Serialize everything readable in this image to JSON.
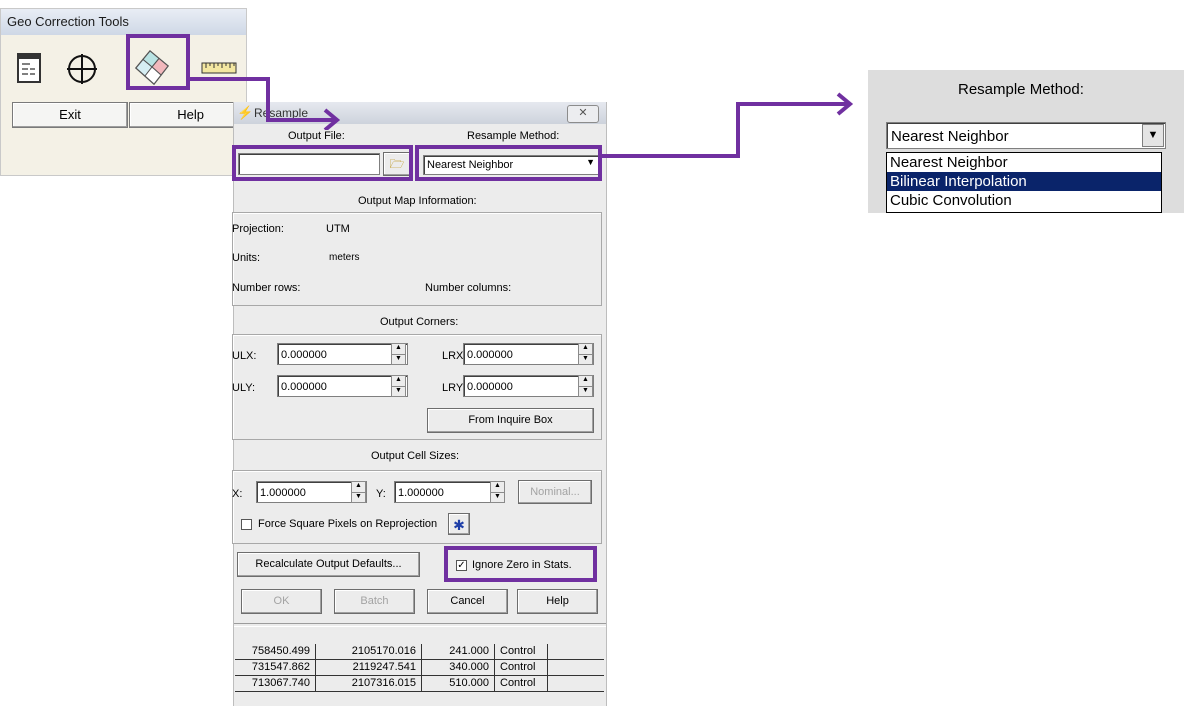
{
  "geo_tools": {
    "title": "Geo Correction Tools",
    "icons": [
      "table-icon",
      "crosshair-icon",
      "resample-icon",
      "ruler-icon"
    ],
    "exit_label": "Exit",
    "help_label": "Help"
  },
  "dialog": {
    "title": "Resample",
    "output_file_label": "Output File:",
    "output_file_value": "",
    "resample_method_label": "Resample Method:",
    "resample_method_value": "Nearest Neighbor",
    "map_info_heading": "Output Map Information:",
    "projection_label": "Projection:",
    "projection_value": "UTM",
    "units_label": "Units:",
    "units_value": "meters",
    "rows_label": "Number rows:",
    "cols_label": "Number columns:",
    "corners_heading": "Output Corners:",
    "ulx_label": "ULX:",
    "ulx_value": "0.000000",
    "lrx_label": "LRX:",
    "lrx_value": "0.000000",
    "uly_label": "ULY:",
    "uly_value": "0.000000",
    "lry_label": "LRY:",
    "lry_value": "0.000000",
    "inquire_button": "From Inquire Box",
    "cell_sizes_heading": "Output Cell Sizes:",
    "x_label": "X:",
    "x_value": "1.000000",
    "y_label": "Y:",
    "y_value": "1.000000",
    "nominal_button": "Nominal...",
    "force_square_label": "Force Square Pixels on Reprojection",
    "recalculate_button": "Recalculate Output Defaults...",
    "ignore_zero_label": "Ignore Zero in Stats.",
    "ignore_zero_checked": true,
    "ok_button": "OK",
    "batch_button": "Batch",
    "cancel_button": "Cancel",
    "help_button": "Help"
  },
  "table": {
    "rows": [
      [
        "758450.499",
        "2105170.016",
        "241.000",
        "Control"
      ],
      [
        "731547.862",
        "2119247.541",
        "340.000",
        "Control"
      ],
      [
        "713067.740",
        "2107316.015",
        "510.000",
        "Control"
      ]
    ]
  },
  "zoom_panel": {
    "heading": "Resample Method:",
    "selected": "Nearest Neighbor",
    "options": [
      "Nearest Neighbor",
      "Bilinear Interpolation",
      "Cubic Convolution"
    ],
    "highlighted_option": "Bilinear Interpolation"
  },
  "colors": {
    "highlight_border": "#7030a0",
    "selection": "#0a246a"
  }
}
